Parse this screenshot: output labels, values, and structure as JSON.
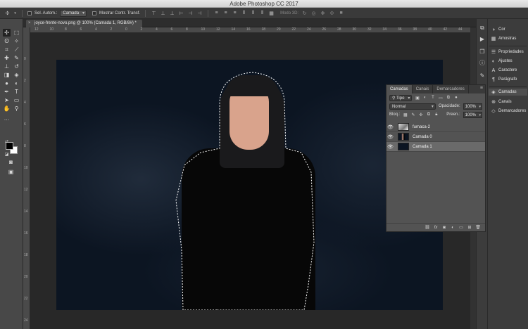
{
  "app": {
    "title": "Adobe Photoshop CC 2017"
  },
  "options_bar": {
    "auto_select_label": "Sel. Autom.:",
    "auto_select_value": "Camada",
    "transform_controls_label": "Mostrar Contr. Transf.",
    "mode_3d_label": "Modo 3D:"
  },
  "document": {
    "tab_title": "joyce-frente-novo.png @ 100% (Camada 1, RGB/8#) *",
    "ruler_h_ticks": [
      "12",
      "10",
      "8",
      "6",
      "4",
      "2",
      "0",
      "2",
      "4",
      "6",
      "8",
      "10",
      "12",
      "14",
      "16",
      "18",
      "20",
      "22",
      "24",
      "26",
      "28",
      "30",
      "32",
      "34",
      "36",
      "38",
      "40",
      "42",
      "44"
    ],
    "ruler_v_ticks": [
      "0",
      "2",
      "4",
      "6",
      "8",
      "10",
      "12",
      "14",
      "16",
      "18",
      "20",
      "22",
      "24"
    ]
  },
  "right_panels": {
    "items": [
      {
        "label": "Cor",
        "icon": "color-wheel-icon"
      },
      {
        "label": "Amostras",
        "icon": "swatches-icon"
      },
      {
        "label": "Propriedades",
        "icon": "properties-icon"
      },
      {
        "label": "Ajustes",
        "icon": "adjustments-icon"
      },
      {
        "label": "Caractere",
        "icon": "character-icon"
      },
      {
        "label": "Parágrafo",
        "icon": "paragraph-icon"
      },
      {
        "label": "Camadas",
        "icon": "layers-icon"
      },
      {
        "label": "Canais",
        "icon": "channels-icon"
      },
      {
        "label": "Demarcadores",
        "icon": "paths-icon"
      }
    ]
  },
  "layers_panel": {
    "tabs": [
      "Camadas",
      "Canais",
      "Demarcadores"
    ],
    "filter_label": "Tipo",
    "blend_mode": "Normal",
    "opacity_label": "Opacidade:",
    "opacity_value": "100%",
    "lock_label": "Bloq.:",
    "fill_label": "Preen.:",
    "fill_value": "100%",
    "layers": [
      {
        "name": "fumaca-2",
        "visible": true,
        "selected": false
      },
      {
        "name": "Camada 0",
        "visible": true,
        "selected": false
      },
      {
        "name": "Camada 1",
        "visible": true,
        "selected": true
      }
    ]
  },
  "colors": {
    "foreground": "#000000",
    "background": "#ffffff",
    "canvas_bg": "#0c1522"
  }
}
